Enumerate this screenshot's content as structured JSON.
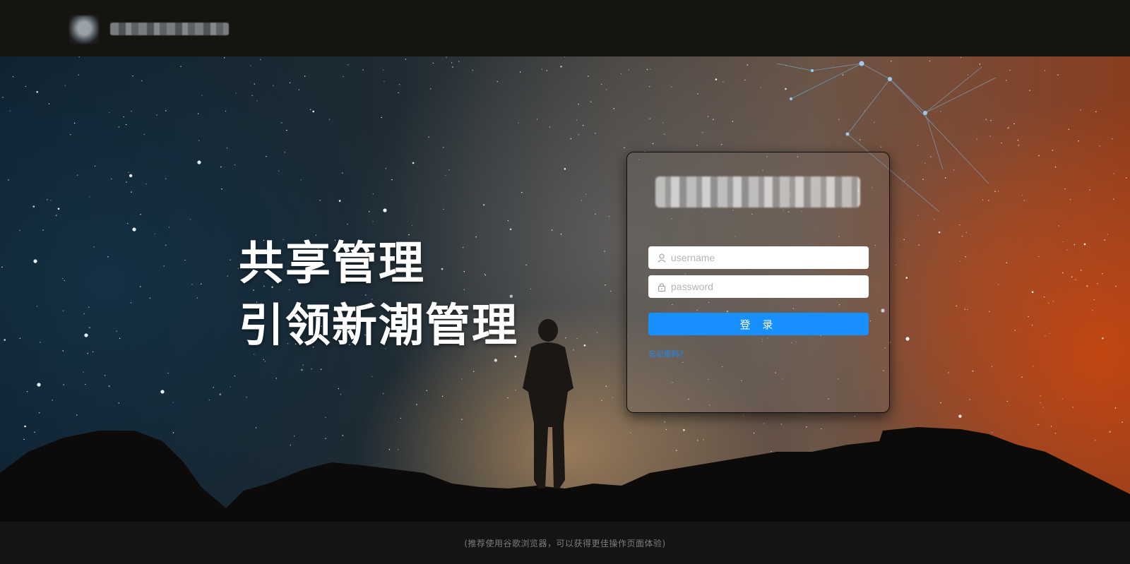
{
  "header": {
    "logo_icon": "app-logo-icon",
    "logo_text_blurred": true
  },
  "hero": {
    "slogan_line1": "共享管理",
    "slogan_line2": "引领新潮管理"
  },
  "login": {
    "title_blurred": true,
    "username_placeholder": "username",
    "username_icon": "user-icon",
    "password_placeholder": "password",
    "password_icon": "lock-icon",
    "submit_label": "登 录",
    "forgot_label": "忘记密码?"
  },
  "footer": {
    "note": "(推荐使用谷歌浏览器，可以获得更佳操作页面体验)"
  },
  "colors": {
    "primary": "#1890ff",
    "header_bg": "#16140f",
    "footer_bg": "#141414"
  }
}
